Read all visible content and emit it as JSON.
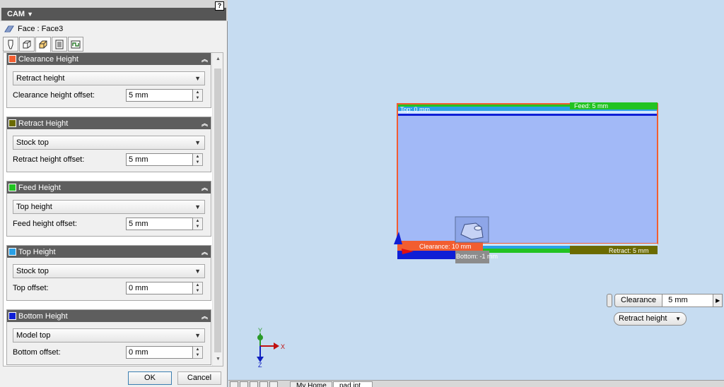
{
  "panel": {
    "title": "CAM",
    "pin_label": "?",
    "face_label": "Face : Face3",
    "tabs": [
      "tool-tab",
      "geometry-tab",
      "heights-tab",
      "passes-tab",
      "linking-tab"
    ],
    "active_tab": 2
  },
  "sections": [
    {
      "title": "Clearance Height",
      "color": "#f25d30",
      "select": "Retract height",
      "label": "Clearance height offset:",
      "value": "5 mm"
    },
    {
      "title": "Retract Height",
      "color": "#6b6b00",
      "select": "Stock top",
      "label": "Retract height offset:",
      "value": "5 mm"
    },
    {
      "title": "Feed Height",
      "color": "#22c322",
      "select": "Top height",
      "label": "Feed height offset:",
      "value": "5 mm"
    },
    {
      "title": "Top Height",
      "color": "#2aa0e6",
      "select": "Stock top",
      "label": "Top offset:",
      "value": "0 mm"
    },
    {
      "title": "Bottom Height",
      "color": "#0f1fd6",
      "select": "Model top",
      "label": "Bottom offset:",
      "value": "0 mm"
    }
  ],
  "buttons": {
    "ok": "OK",
    "cancel": "Cancel"
  },
  "viewport": {
    "labels": {
      "top": "Top: 0 mm",
      "feed": "Feed: 5 mm",
      "clearance": "Clearance: 10 mm",
      "bottom": "Bottom: -1 mm",
      "retract": "Retract: 5 mm"
    },
    "axes": {
      "x": "X",
      "y": "Y",
      "z": "Z"
    }
  },
  "hud": {
    "label": "Clearance",
    "value": "5 mm",
    "dropdown": "Retract height"
  },
  "doc_tabs": {
    "home": "My Home",
    "file": "pad.ipt"
  },
  "colors": {
    "clearance": "#f25d30",
    "retract": "#6b6b00",
    "feed": "#22c322",
    "top": "#2aa0e6",
    "bottom": "#0f1fd6",
    "stock_fill": "#a2b9f7"
  }
}
